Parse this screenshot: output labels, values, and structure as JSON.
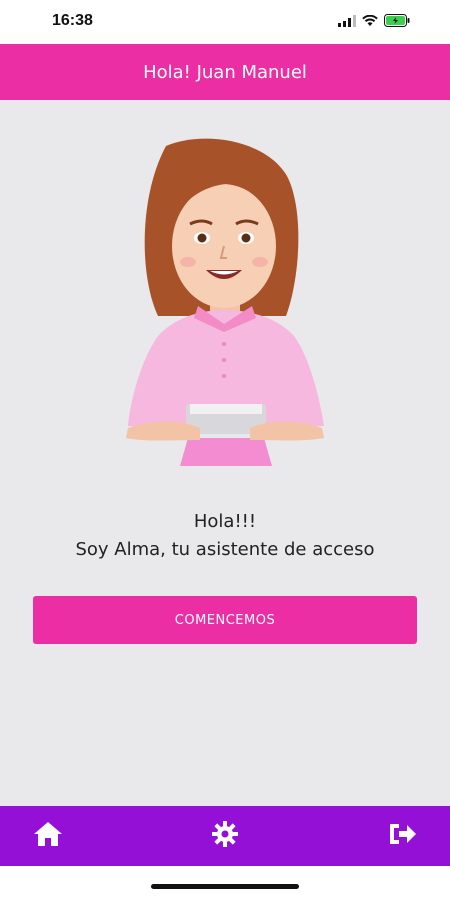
{
  "status_bar": {
    "time": "16:38"
  },
  "header": {
    "title": "Hola! Juan Manuel"
  },
  "main": {
    "greeting_line1": "Hola!!!",
    "greeting_line2": "Soy Alma, tu asistente de acceso",
    "cta_label": "COMENCEMOS"
  },
  "bottom_nav": {
    "items": [
      {
        "icon": "home-icon"
      },
      {
        "icon": "gear-icon"
      },
      {
        "icon": "logout-icon"
      }
    ]
  },
  "colors": {
    "accent": "#ec2ea4",
    "nav_bg": "#9410d6",
    "page_bg": "#e9e8ea"
  }
}
